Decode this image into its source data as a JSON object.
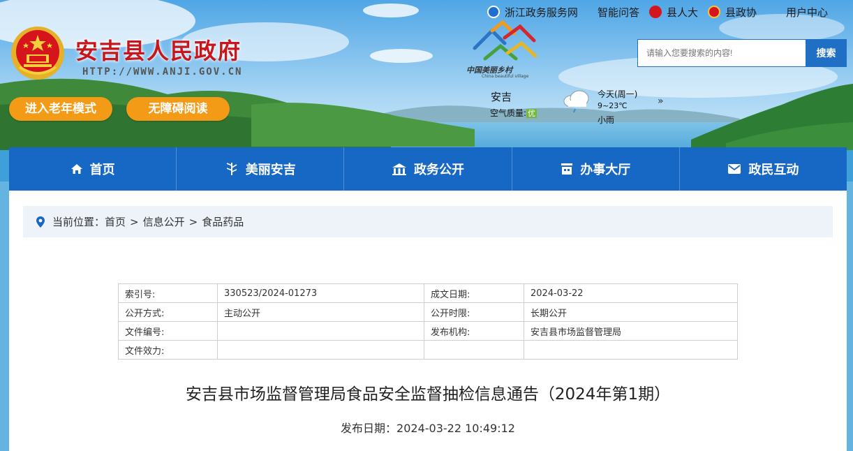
{
  "top_links": [
    {
      "label": "浙江政务服务网",
      "icon": "zhejiang-gov-service-icon"
    },
    {
      "label": "智能问答",
      "icon": ""
    },
    {
      "label": "县人大",
      "icon": "party-emblem-icon"
    },
    {
      "label": "县政协",
      "icon": "cppcc-emblem-icon"
    },
    {
      "label": "用户中心",
      "icon": ""
    }
  ],
  "site": {
    "title": "安吉县人民政府",
    "url": "HTTP://WWW.ANJI.GOV.CN"
  },
  "mode_buttons": {
    "elder": "进入老年模式",
    "accessible": "无障碍阅读"
  },
  "village_logo": {
    "cn": "中国美丽乡村",
    "en": "China beautiful village"
  },
  "search": {
    "placeholder": "请输入您要搜索的内容!",
    "button": "搜索"
  },
  "weather": {
    "city": "安吉",
    "air_quality_label": "空气质量:",
    "air_quality_level": "优",
    "day": "今天(周一)",
    "temp": "9~23℃",
    "condition": "小雨",
    "more": "»"
  },
  "nav": [
    {
      "label": "首页",
      "icon": "home-icon"
    },
    {
      "label": "美丽安吉",
      "icon": "bamboo-icon"
    },
    {
      "label": "政务公开",
      "icon": "gov-building-icon"
    },
    {
      "label": "办事大厅",
      "icon": "service-hall-icon"
    },
    {
      "label": "政民互动",
      "icon": "mail-icon"
    }
  ],
  "breadcrumb": {
    "prefix": "当前位置：",
    "items": [
      "首页",
      "信息公开",
      "食品药品"
    ],
    "separator": ">"
  },
  "meta": {
    "index_label": "索引号:",
    "index_value": "330523/2024-01273",
    "date_label": "成文日期:",
    "date_value": "2024-03-22",
    "mode_label": "公开方式:",
    "mode_value": "主动公开",
    "period_label": "公开时限:",
    "period_value": "长期公开",
    "docno_label": "文件编号:",
    "docno_value": "",
    "org_label": "发布机构:",
    "org_value": "安吉县市场监督管理局",
    "validity_label": "文件效力:",
    "validity_value": ""
  },
  "article": {
    "title": "安吉县市场监督管理局食品安全监督抽检信息通告（2024年第1期）",
    "publish_date": "发布日期：2024-03-22 10:49:12"
  },
  "colors": {
    "nav_blue": "#1767c4",
    "title_red": "#c8161d",
    "pill_orange": "#f39a16"
  }
}
